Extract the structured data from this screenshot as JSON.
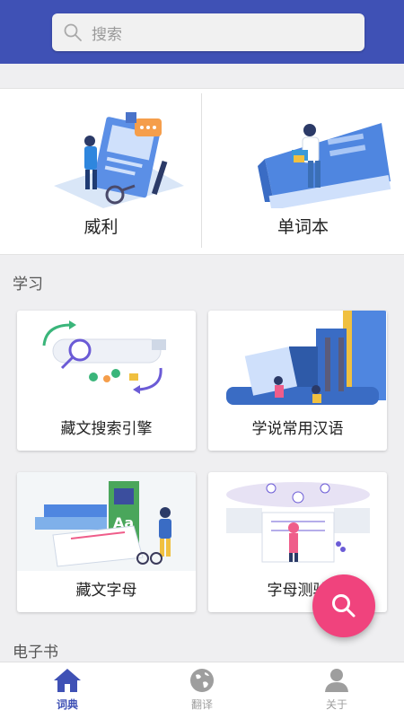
{
  "search": {
    "placeholder": "搜索"
  },
  "top_items": [
    {
      "label": "威利"
    },
    {
      "label": "单词本"
    }
  ],
  "sections": [
    {
      "title": "学习"
    },
    {
      "title": "电子书"
    }
  ],
  "cards": [
    {
      "label": "藏文搜索引擎"
    },
    {
      "label": "学说常用汉语"
    },
    {
      "label": "藏文字母"
    },
    {
      "label": "字母测验"
    }
  ],
  "bottom_nav": [
    {
      "label": "词典",
      "icon": "home-icon",
      "active": true
    },
    {
      "label": "翻译",
      "icon": "globe-icon",
      "active": false
    },
    {
      "label": "关于",
      "icon": "person-icon",
      "active": false
    }
  ],
  "colors": {
    "primary": "#3f51b5",
    "fab": "#f0437d"
  }
}
